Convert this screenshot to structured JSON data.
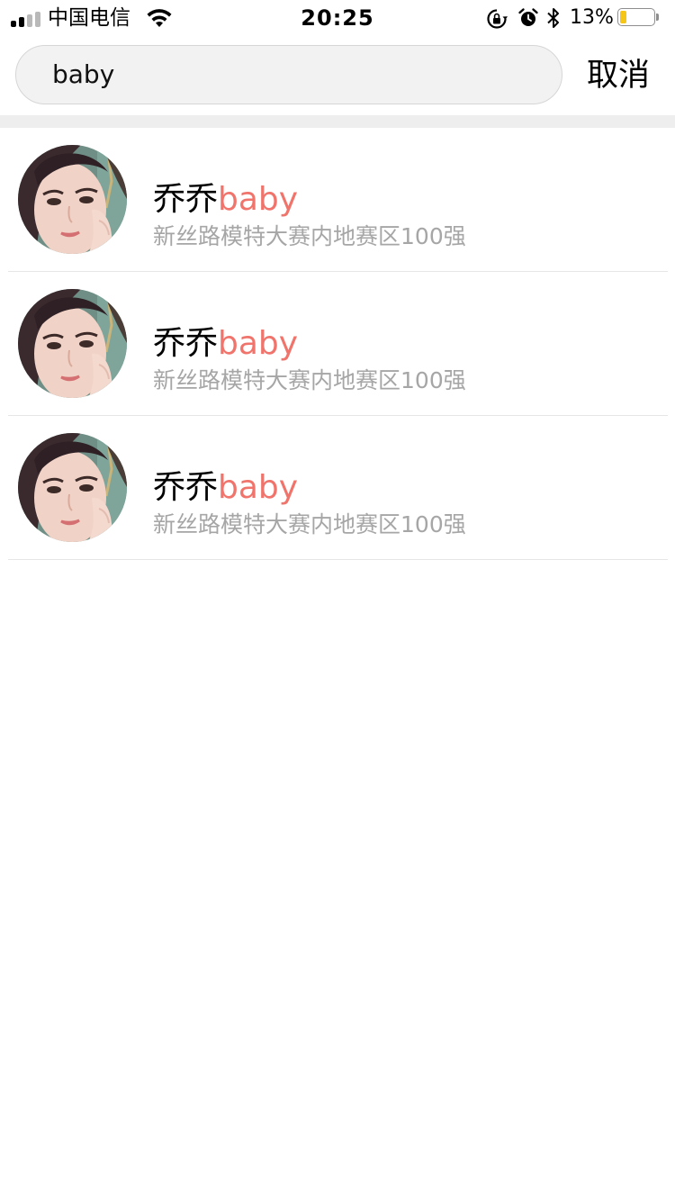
{
  "status_bar": {
    "carrier": "中国电信",
    "time": "20:25",
    "battery_percent": "13%",
    "battery_level": 0.13,
    "battery_color": "#f5c518",
    "icons": [
      "signal-icon",
      "wifi-icon",
      "rotation-lock-icon",
      "alarm-icon",
      "bluetooth-icon",
      "battery-icon"
    ]
  },
  "search": {
    "value": "baby",
    "cancel_label": "取消"
  },
  "colors": {
    "highlight": "#f0746b",
    "subtitle": "#a6a6a6",
    "search_bg": "#f2f2f2"
  },
  "results": [
    {
      "name_prefix": "乔乔",
      "name_match": "baby",
      "description": "新丝路模特大赛内地赛区100强"
    },
    {
      "name_prefix": "乔乔",
      "name_match": "baby",
      "description": "新丝路模特大赛内地赛区100强"
    },
    {
      "name_prefix": "乔乔",
      "name_match": "baby",
      "description": "新丝路模特大赛内地赛区100强"
    }
  ]
}
